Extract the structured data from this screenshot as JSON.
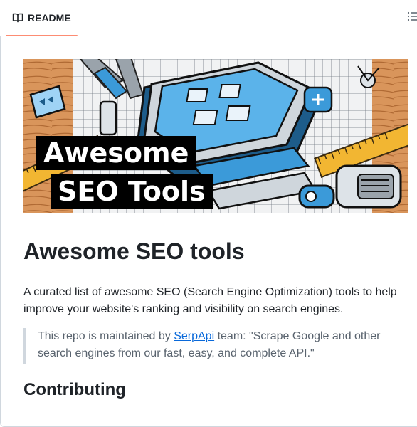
{
  "tab": {
    "label": "README",
    "icon": "book-icon"
  },
  "toc": {
    "icon": "list-unordered-icon"
  },
  "hero": {
    "title_line1": "Awesome",
    "title_line2": "SEO Tools",
    "colors": {
      "blue": "#3b9ad9",
      "dark_blue": "#1d5c8a",
      "wood": "#d9955b",
      "ruler": "#f2b632"
    }
  },
  "heading": "Awesome SEO tools",
  "intro": "A curated list of awesome SEO (Search Engine Optimization) tools to help improve your website's ranking and visibility on search engines.",
  "note": {
    "before": "This repo is maintained by ",
    "link": "SerpApi",
    "after": " team: \"Scrape Google and other search engines from our fast, easy, and complete API.\""
  },
  "section_heading": "Contributing",
  "colors": {
    "accent_underline": "#fd8c73",
    "link": "#0969da",
    "muted": "#59636e"
  }
}
